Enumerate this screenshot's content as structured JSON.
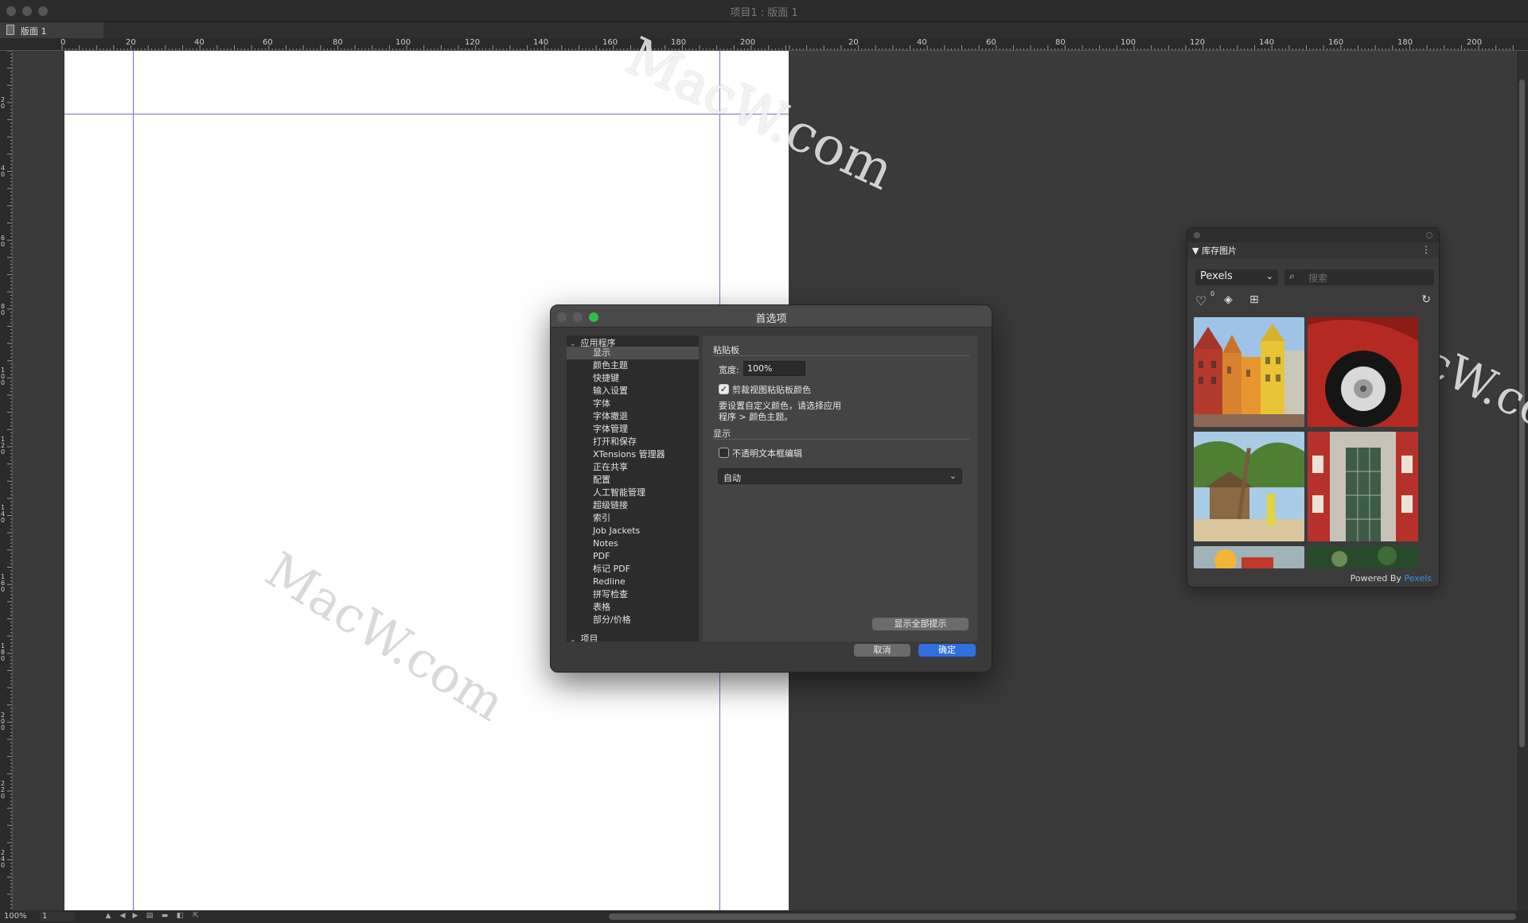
{
  "window": {
    "title": "项目1 : 版面 1"
  },
  "layout_tab": {
    "label": "版面 1"
  },
  "rulers": {
    "horizontal_left": [
      "0",
      "20",
      "40",
      "60",
      "80",
      "100",
      "120",
      "140",
      "160",
      "180",
      "200"
    ],
    "horizontal_right": [
      "20",
      "40",
      "60",
      "80",
      "100",
      "120",
      "140",
      "160",
      "180",
      "200"
    ],
    "vertical": [
      "2\n0",
      "4\n0",
      "6\n0",
      "8\n0",
      "1\n0\n0",
      "1\n2\n0",
      "1\n4\n0",
      "1\n6\n0",
      "1\n8\n0",
      "2\n0\n0",
      "2\n2\n0",
      "2\n4\n0"
    ]
  },
  "status_bar": {
    "zoom": "100%",
    "page": "1"
  },
  "watermark": {
    "text": "MacW.com"
  },
  "preferences": {
    "title": "首选项",
    "tree": {
      "group_app": "应用程序",
      "items": [
        "显示",
        "颜色主题",
        "快捷键",
        "输入设置",
        "字体",
        "字体撤退",
        "字体管理",
        "打开和保存",
        "XTensions 管理器",
        "正在共享",
        "配置",
        "人工智能管理",
        "超级链接",
        "索引",
        "Job Jackets",
        "Notes",
        "PDF",
        "标记 PDF",
        "Redline",
        "拼写检查",
        "表格",
        "部分/价格"
      ],
      "selected": "显示",
      "group_project": "项目"
    },
    "pane": {
      "section_pasteboard": "粘贴板",
      "width_label": "宽度:",
      "width_value": "100%",
      "clip_label": "剪裁视图粘贴板颜色",
      "clip_checked": true,
      "note_line1": "要设置自定义颜色，请选择应用",
      "note_line2": "程序 > 颜色主题。",
      "section_display": "显示",
      "opaque_label": "不透明文本框编辑",
      "opaque_checked": false,
      "mode_value": "自动",
      "show_tips": "显示全部提示"
    },
    "cancel": "取消",
    "ok": "确定"
  },
  "stock_panel": {
    "title": "库存图片",
    "provider": "Pexels",
    "search_placeholder": "搜索",
    "favorites_count": "0",
    "footer_prefix": "Powered By",
    "footer_brand": "Pexels"
  }
}
